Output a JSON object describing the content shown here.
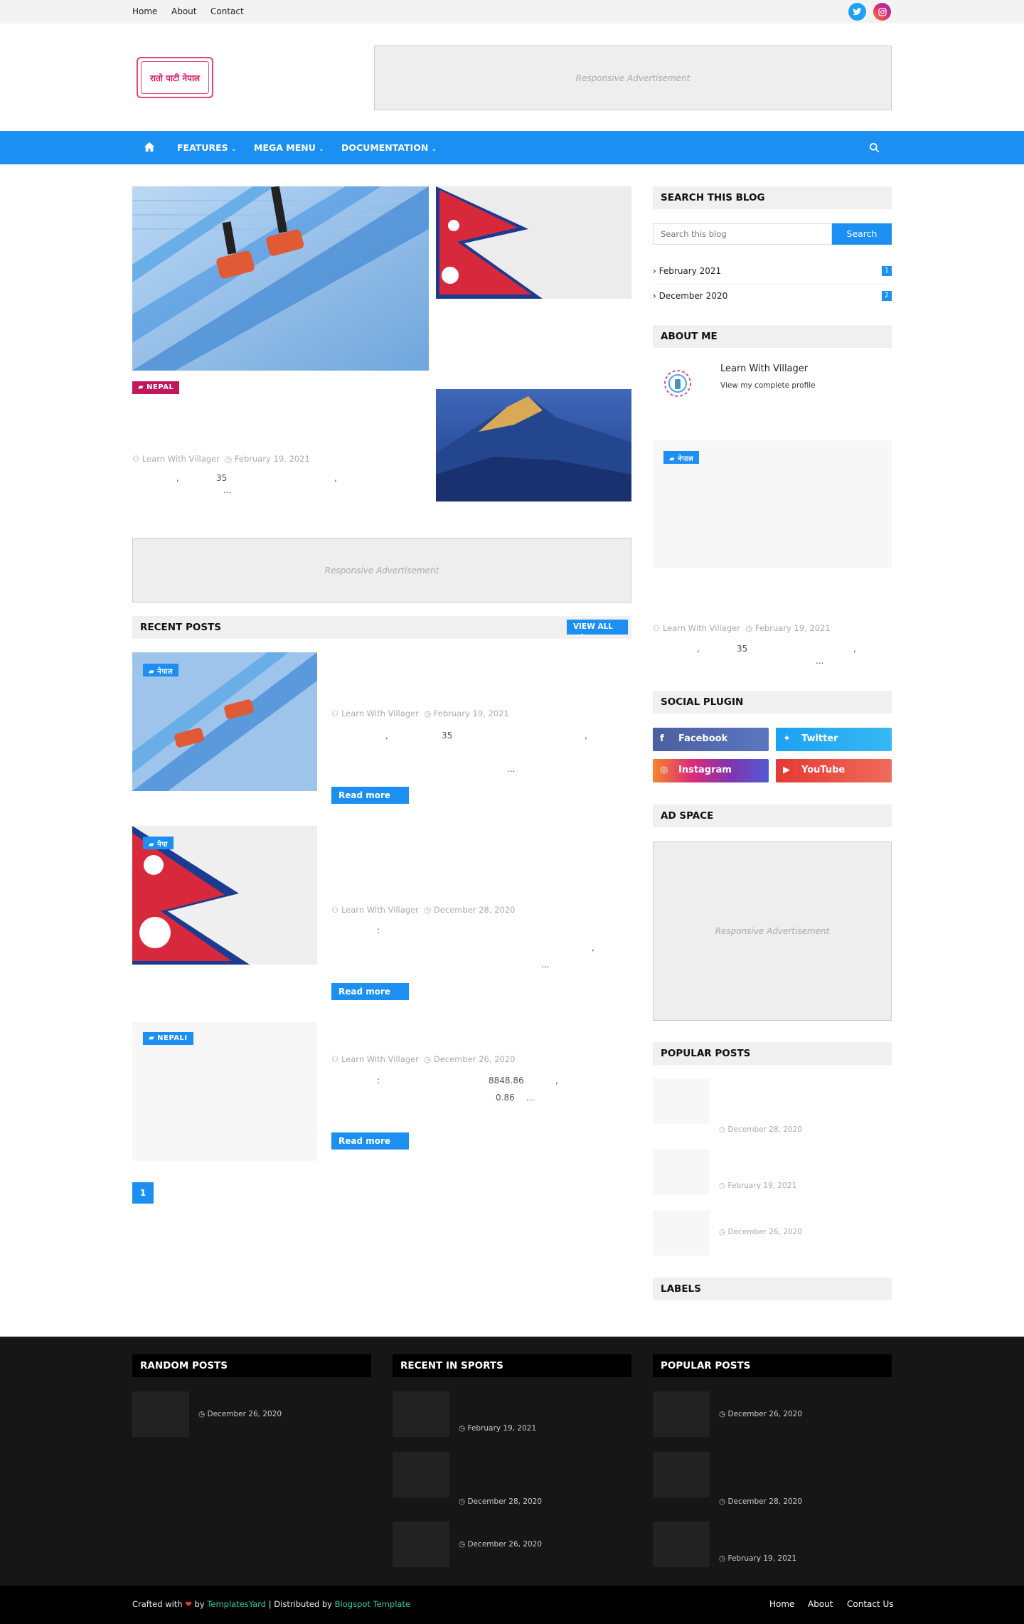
{
  "topbar": {
    "links": [
      "Home",
      "About",
      "Contact"
    ]
  },
  "header": {
    "logo_text": "रातो पाटी नेपाल",
    "ad_label": "Responsive Advertisement"
  },
  "nav": {
    "items": [
      "FEATURES",
      "MEGA MENU",
      "DOCUMENTATION"
    ]
  },
  "featured": {
    "tag": "NEPAL",
    "author": "Learn With Villager",
    "date": "February 19, 2021",
    "excerpt_a": ",",
    "excerpt_b": "35",
    "excerpt_c": ",",
    "excerpt_d": "..."
  },
  "mid_ad": {
    "label": "Responsive Advertisement"
  },
  "recent": {
    "title": "RECENT POSTS",
    "view_all": "VIEW ALL",
    "posts": [
      {
        "tag": "नेपाल",
        "author": "Learn With Villager",
        "date": "February 19, 2021",
        "line1a": ",",
        "line1b": "35",
        "line1c": ",",
        "line2": "...",
        "read_more": "Read more"
      },
      {
        "tag": "नेपा",
        "author": "Learn With Villager",
        "date": "December 28, 2020",
        "line1a": ":",
        "line1c": ",",
        "line2": "...",
        "read_more": "Read more"
      },
      {
        "tag": "NEPALI",
        "author": "Learn With Villager",
        "date": "December 26, 2020",
        "line1a": ":",
        "line1b": "8848.86",
        "line1c": ",",
        "line2b": "0.86",
        "line2": "...",
        "read_more": "Read more"
      }
    ],
    "page": "1"
  },
  "sidebar": {
    "search_title": "SEARCH THIS BLOG",
    "search_placeholder": "Search this blog",
    "search_button": "Search",
    "archive": [
      {
        "label": "February 2021",
        "count": "1"
      },
      {
        "label": "December 2020",
        "count": "2"
      }
    ],
    "about_title": "ABOUT ME",
    "about_name": "Learn With Villager",
    "about_link": "View my complete profile",
    "featured_tag": "नेपाल",
    "featured_author": "Learn With Villager",
    "featured_date": "February 19, 2021",
    "featured_a": ",",
    "featured_b": "35",
    "featured_c": ",",
    "featured_d": "...",
    "social_title": "SOCIAL PLUGIN",
    "social": [
      "Facebook",
      "Twitter",
      "Instagram",
      "YouTube"
    ],
    "ad_title": "AD SPACE",
    "ad_label": "Responsive Advertisement",
    "popular_title": "POPULAR POSTS",
    "popular_dates": [
      "December 28, 2020",
      "February 19, 2021",
      "December 26, 2020"
    ],
    "labels_title": "LABELS"
  },
  "footer": {
    "random_title": "RANDOM POSTS",
    "random_dates": [
      "December 26, 2020"
    ],
    "sports_title": "RECENT IN SPORTS",
    "sports_dates": [
      "February 19, 2021",
      "December 28, 2020",
      "December 26, 2020"
    ],
    "popular_title": "POPULAR POSTS",
    "popular_dates": [
      "December 26, 2020",
      "December 28, 2020",
      "February 19, 2021"
    ],
    "crafted": "Crafted with",
    "by": "by",
    "templatesyard": "TemplatesYard",
    "distributed": "| Distributed by",
    "blogspot": "Blogspot Template",
    "links": [
      "Home",
      "About",
      "Contact Us"
    ]
  },
  "colors": {
    "accent": "#1b8ff2",
    "tag_pink": "#c2185b",
    "footer_bg": "#161616",
    "footer_bottom": "#000000"
  }
}
